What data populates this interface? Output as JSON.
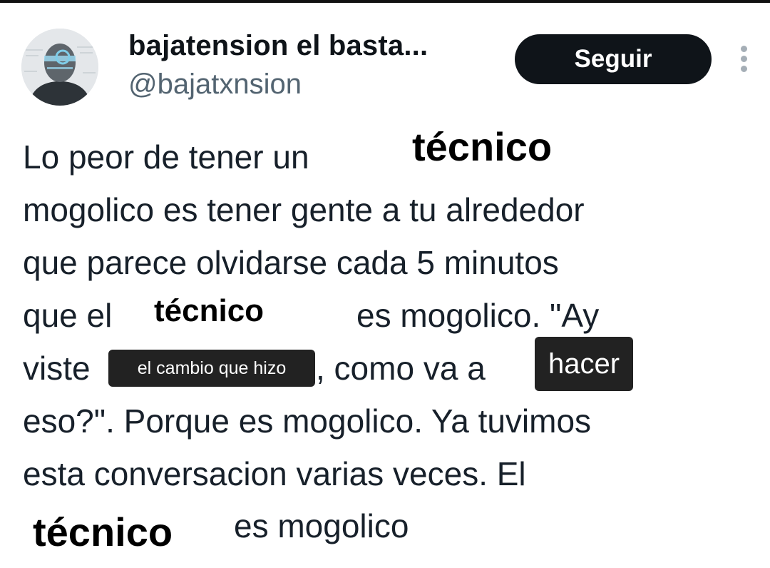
{
  "profile": {
    "avatar_icon": "user-avatar",
    "display_name": "bajatension el basta...",
    "handle": "@bajatxnsion"
  },
  "actions": {
    "follow_label": "Seguir",
    "more_icon": "more-vertical-icon"
  },
  "tweet": {
    "line1": "Lo peor de tener un",
    "line2": "mogolico es tener gente a tu alrededor",
    "line3": "que parece olvidarse cada 5 minutos",
    "line4a": "que el",
    "line4b": "es mogolico. \"Ay",
    "line5a": "viste",
    "line5b": ", como va a",
    "line6": "eso?\". Porque es mogolico. Ya tuvimos",
    "line7": "esta conversacion varias veces. El",
    "line8": "es mogolico"
  },
  "overlays": {
    "word1": "técnico",
    "word2": "técnico",
    "phrase": "el cambio que hizo",
    "verb": "hacer",
    "word3": "técnico"
  },
  "colors": {
    "button_bg": "#0f1419",
    "text": "#17202a",
    "handle": "#536471",
    "overlay_box": "#222222"
  }
}
